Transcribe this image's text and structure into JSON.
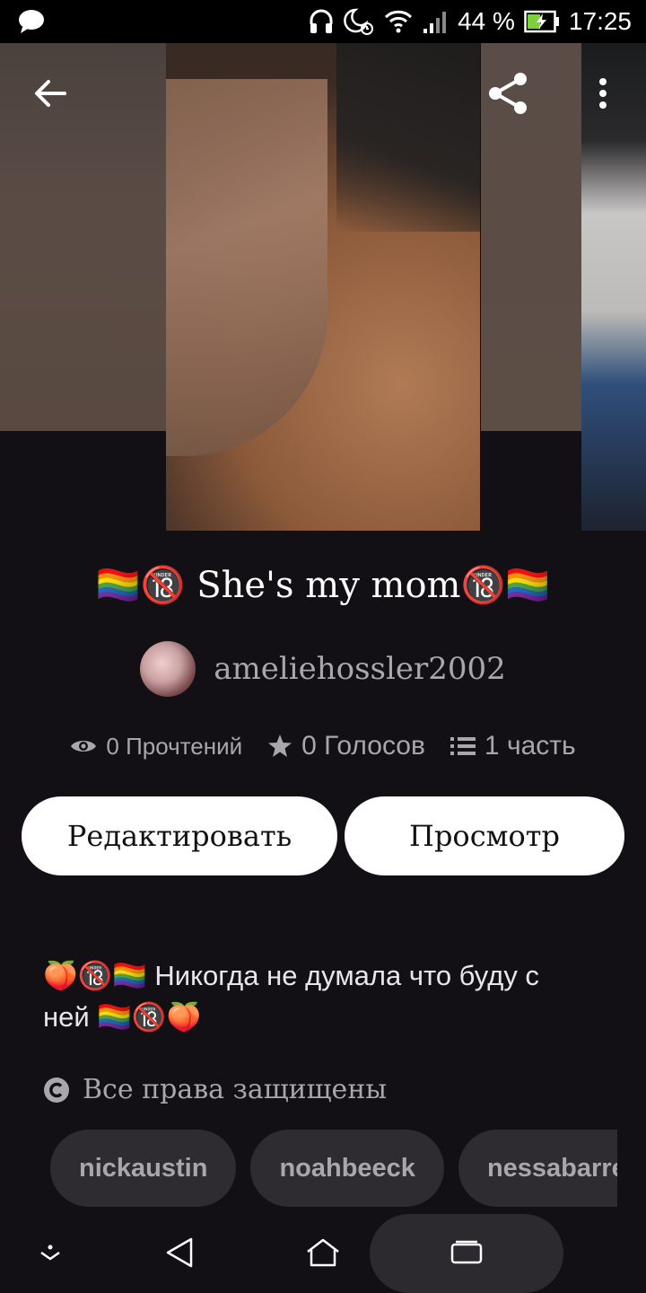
{
  "status_bar": {
    "battery": "44 %",
    "time": "17:25"
  },
  "story": {
    "title": "🏳️‍🌈🔞 She's my mom🔞🏳️‍🌈",
    "author": "ameliehossler2002",
    "reads_count": "0",
    "reads_label": "Прочтений",
    "votes_count": "0",
    "votes_label": "Голосов",
    "parts_count": "1",
    "parts_label": "часть",
    "description_line1": "🍑🔞🏳️‍🌈 Никогда не думала что буду с",
    "description_line2": "ней 🏳️‍🌈🔞🍑",
    "copyright": "Все права защищены"
  },
  "actions": {
    "edit_label": "Редактировать",
    "view_label": "Просмотр"
  },
  "tags": [
    "nickaustin",
    "noahbeeck",
    "nessabarrett"
  ]
}
